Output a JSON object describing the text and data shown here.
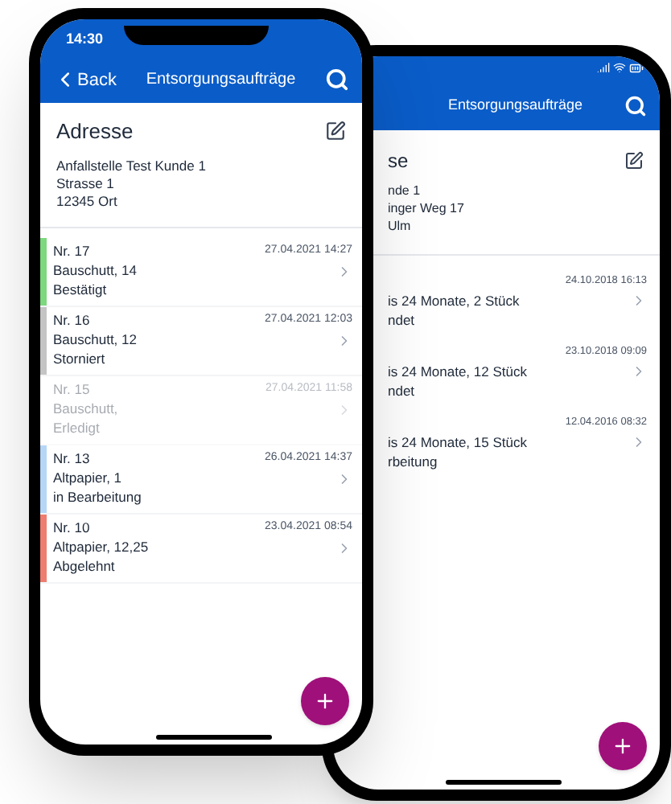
{
  "front_phone": {
    "status_bar": {
      "time": "14:30"
    },
    "nav_bar": {
      "back": "Back",
      "title": "Entsorgungsaufträge"
    },
    "address": {
      "heading": "Adresse",
      "lines": [
        "Anfallstelle Test Kunde 1",
        "Strasse 1",
        "12345 Ort"
      ]
    },
    "orders": [
      {
        "number": "Nr. 17",
        "material": "Bauschutt, 14",
        "status": "Bestätigt",
        "datetime": "27.04.2021 14:27",
        "color": "#7ed87e",
        "faded": false
      },
      {
        "number": "Nr. 16",
        "material": "Bauschutt, 12",
        "status": "Storniert",
        "datetime": "27.04.2021 12:03",
        "color": "#c4c4c4",
        "faded": false
      },
      {
        "number": "Nr. 15",
        "material": "Bauschutt,",
        "status": "Erledigt",
        "datetime": "27.04.2021 11:58",
        "faded": true
      },
      {
        "number": "Nr. 13",
        "material": "Altpapier, 1",
        "status": "in Bearbeitung",
        "datetime": "26.04.2021 14:37",
        "color": "#b6d6f6",
        "faded": false
      },
      {
        "number": "Nr. 10",
        "material": "Altpapier, 12,25",
        "status": "Abgelehnt",
        "datetime": "23.04.2021 08:54",
        "color": "#ee7d70",
        "faded": false
      }
    ]
  },
  "back_phone": {
    "nav_bar": {
      "title": "Entsorgungsaufträge"
    },
    "address": {
      "heading": "se",
      "lines": [
        "nde 1",
        "inger Weg 17",
        "Ulm"
      ]
    },
    "orders": [
      {
        "material": "is 24 Monate, 2 Stück",
        "status": "ndet",
        "datetime": "24.10.2018 16:13"
      },
      {
        "material": "is 24 Monate, 12 Stück",
        "status": "ndet",
        "datetime": "23.10.2018 09:09"
      },
      {
        "material": "is 24 Monate, 15 Stück",
        "status": "rbeitung",
        "datetime": "12.04.2016 08:32"
      }
    ]
  }
}
